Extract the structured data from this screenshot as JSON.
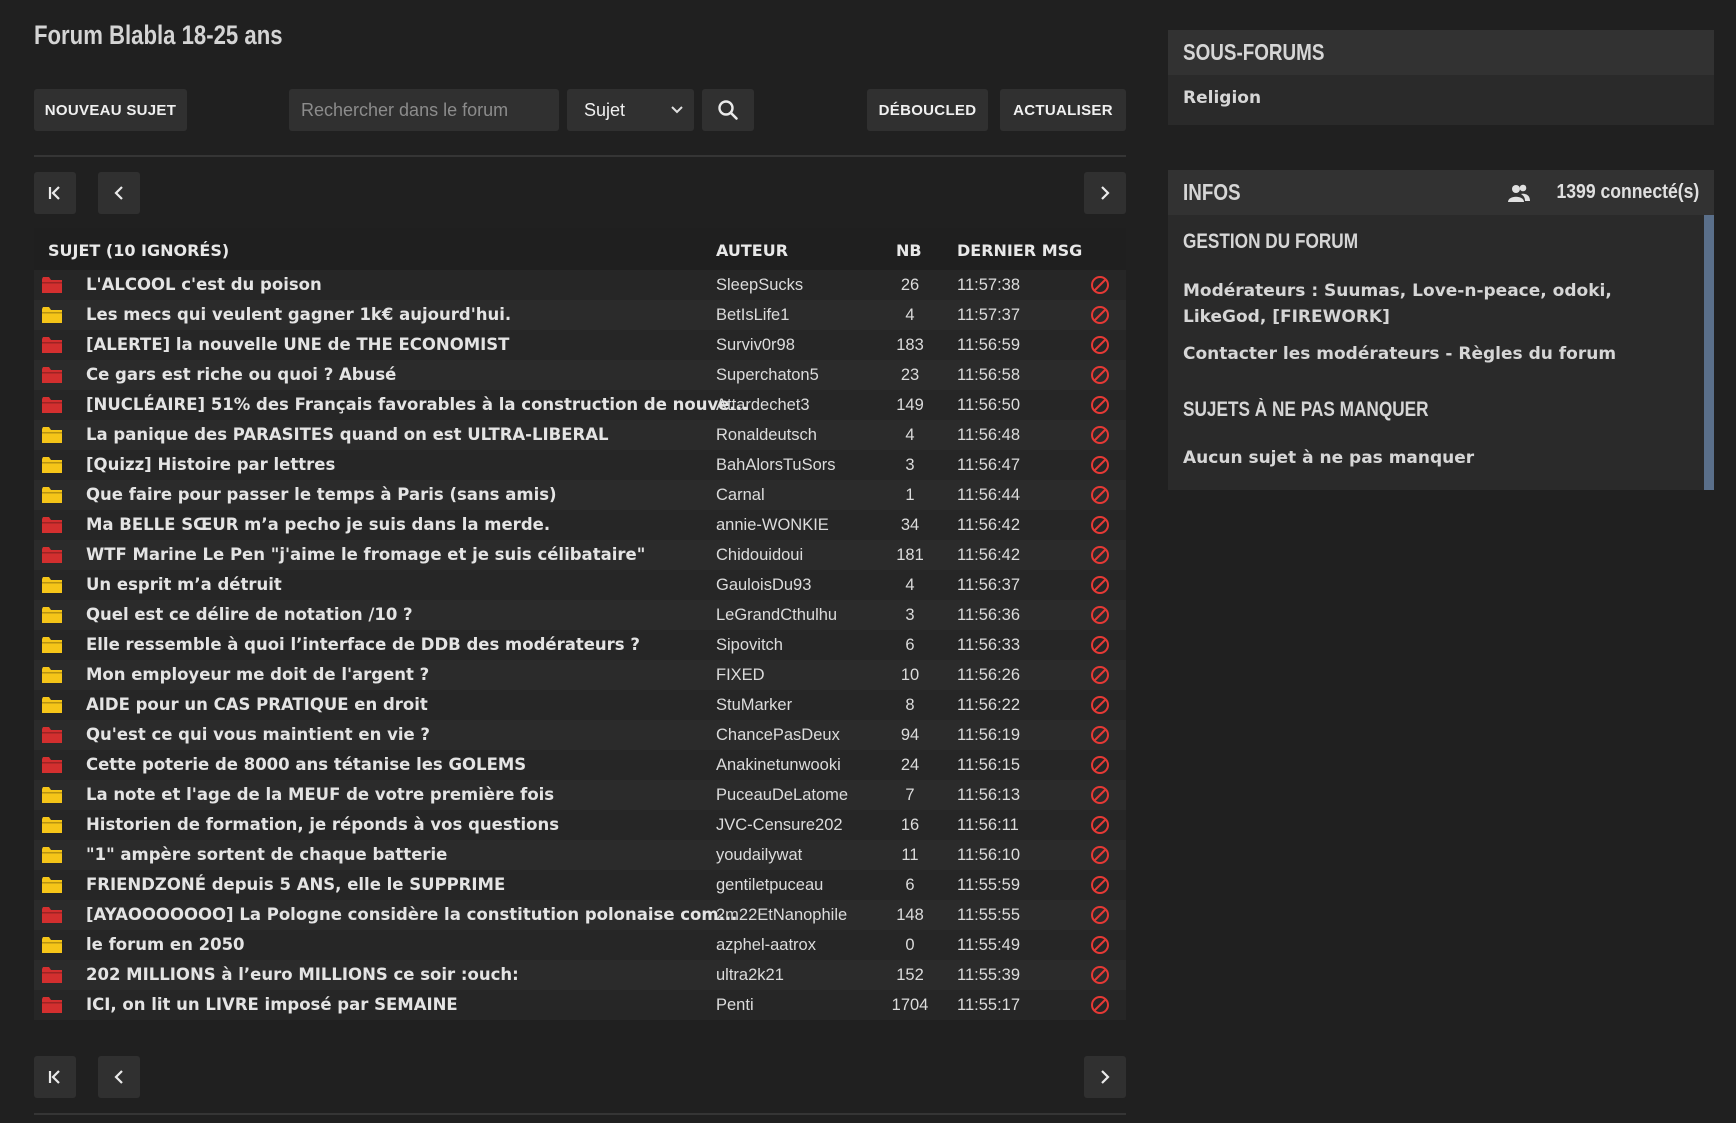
{
  "forum_title": "Forum Blabla 18-25 ans",
  "toolbar": {
    "new_topic": "NOUVEAU SUJET",
    "search_placeholder": "Rechercher dans le forum",
    "search_scope": "Sujet",
    "deboucled": "DÉBOUCLED",
    "refresh": "ACTUALISER"
  },
  "table": {
    "headers": {
      "subject": "SUJET (10 IGNORÉS)",
      "author": "AUTEUR",
      "nb": "NB",
      "last_msg": "DERNIER MSG"
    },
    "rows": [
      {
        "folder": "red",
        "subject": "L'ALCOOL c'est du poison",
        "author": "SleepSucks",
        "nb": "26",
        "time": "11:57:38"
      },
      {
        "folder": "yellow",
        "subject": "Les mecs qui veulent gagner 1k€ aujourd'hui.",
        "author": "BetIsLife1",
        "nb": "4",
        "time": "11:57:37"
      },
      {
        "folder": "red",
        "subject": "[ALERTE] la nouvelle UNE de THE ECONOMIST",
        "author": "Surviv0r98",
        "nb": "183",
        "time": "11:56:59"
      },
      {
        "folder": "red",
        "subject": "Ce gars est riche ou quoi ? Abusé",
        "author": "Superchaton5",
        "nb": "23",
        "time": "11:56:58"
      },
      {
        "folder": "red",
        "subject": "[NUCLÉAIRE] 51% des Français favorables à la construction de nouve...",
        "author": "Attardechet3",
        "nb": "149",
        "time": "11:56:50"
      },
      {
        "folder": "yellow",
        "subject": "La panique des PARASITES quand on est ULTRA-LIBERAL",
        "author": "Ronaldeutsch",
        "nb": "4",
        "time": "11:56:48"
      },
      {
        "folder": "yellow",
        "subject": "[Quizz] Histoire par lettres",
        "author": "BahAlorsTuSors",
        "nb": "3",
        "time": "11:56:47"
      },
      {
        "folder": "yellow",
        "subject": "Que faire pour passer le temps à Paris (sans amis)",
        "author": "Carnal",
        "nb": "1",
        "time": "11:56:44"
      },
      {
        "folder": "red",
        "subject": "Ma BELLE SŒUR m’a pecho je suis dans la merde.",
        "author": "annie-WONKIE",
        "nb": "34",
        "time": "11:56:42"
      },
      {
        "folder": "red",
        "subject": "WTF Marine Le Pen \"j'aime le fromage et je suis célibataire\"",
        "author": "Chidouidoui",
        "nb": "181",
        "time": "11:56:42"
      },
      {
        "folder": "yellow",
        "subject": "Un esprit m’a détruit",
        "author": "GauloisDu93",
        "nb": "4",
        "time": "11:56:37"
      },
      {
        "folder": "yellow",
        "subject": "Quel est ce délire de notation /10 ?",
        "author": "LeGrandCthulhu",
        "nb": "3",
        "time": "11:56:36"
      },
      {
        "folder": "yellow",
        "subject": "Elle ressemble à quoi l’interface de DDB des modérateurs ?",
        "author": "Sipovitch",
        "nb": "6",
        "time": "11:56:33"
      },
      {
        "folder": "yellow",
        "subject": "Mon employeur me doit de l'argent ?",
        "author": "FIXED",
        "nb": "10",
        "time": "11:56:26"
      },
      {
        "folder": "yellow",
        "subject": "AIDE pour un CAS PRATIQUE en droit",
        "author": "StuMarker",
        "nb": "8",
        "time": "11:56:22"
      },
      {
        "folder": "red",
        "subject": "Qu'est ce qui vous maintient en vie ?",
        "author": "ChancePasDeux",
        "nb": "94",
        "time": "11:56:19"
      },
      {
        "folder": "red",
        "subject": "Cette poterie de 8000 ans tétanise les GOLEMS",
        "author": "Anakinetunwooki",
        "nb": "24",
        "time": "11:56:15"
      },
      {
        "folder": "yellow",
        "subject": "La note et l'age de la MEUF de votre première fois",
        "author": "PuceauDeLatome",
        "nb": "7",
        "time": "11:56:13"
      },
      {
        "folder": "yellow",
        "subject": "Historien de formation, je réponds à vos questions",
        "author": "JVC-Censure202",
        "nb": "16",
        "time": "11:56:11"
      },
      {
        "folder": "yellow",
        "subject": "\"1\" ampère sortent de chaque batterie",
        "author": "youdailywat",
        "nb": "11",
        "time": "11:56:10"
      },
      {
        "folder": "yellow",
        "subject": "FRIENDZONÉ depuis 5 ANS, elle le SUPPRIME",
        "author": "gentiletpuceau",
        "nb": "6",
        "time": "11:55:59"
      },
      {
        "folder": "red",
        "subject": "[AYAOOOOOOO] La Pologne considère la constitution polonaise com...",
        "author": "2m22EtNanophile",
        "nb": "148",
        "time": "11:55:55"
      },
      {
        "folder": "yellow",
        "subject": "le forum en 2050",
        "author": "azphel-aatrox",
        "nb": "0",
        "time": "11:55:49"
      },
      {
        "folder": "red",
        "subject": "202 MILLIONS à l’euro MILLIONS ce soir :ouch:",
        "author": "ultra2k21",
        "nb": "152",
        "time": "11:55:39"
      },
      {
        "folder": "red",
        "subject": "ICI, on lit un LIVRE imposé par SEMAINE",
        "author": "Penti",
        "nb": "1704",
        "time": "11:55:17"
      }
    ]
  },
  "colors": {
    "folder_red": "#d32f2f",
    "folder_yellow": "#f5c518",
    "ban": "#e53935",
    "scrollbar": "#5a6f8a"
  },
  "sidebar": {
    "subforums": {
      "title": "SOUS-FORUMS",
      "items": [
        "Religion"
      ]
    },
    "infos": {
      "title": "INFOS",
      "connected": "1399 connecté(s)",
      "management_title": "GESTION DU FORUM",
      "moderators": "Modérateurs : Suumas, Love-n-peace, odoki, LikeGod, [FIREWORK]",
      "contact": "Contacter les modérateurs - Règles du forum",
      "must_read_title": "SUJETS À NE PAS MANQUER",
      "must_read_empty": "Aucun sujet à ne pas manquer"
    }
  }
}
